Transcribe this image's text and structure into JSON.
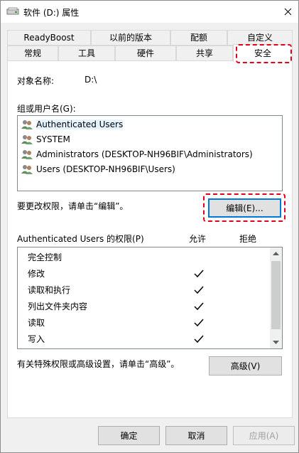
{
  "window": {
    "title": "软件 (D:) 属性"
  },
  "tabs_row1": [
    "ReadyBoost",
    "以前的版本",
    "配额",
    "自定义"
  ],
  "tabs_row2": [
    "常规",
    "工具",
    "硬件",
    "共享",
    "安全"
  ],
  "selected_tab": "安全",
  "object": {
    "label": "对象名称:",
    "value": "D:\\"
  },
  "group_label": "组或用户名(G):",
  "users": [
    "Authenticated Users",
    "SYSTEM",
    "Administrators (DESKTOP-NH96BIF\\Administrators)",
    "Users (DESKTOP-NH96BIF\\Users)"
  ],
  "edit_hint": "要更改权限，请单击“编辑”。",
  "edit_button": "编辑(E)...",
  "perm_header": {
    "title": "Authenticated Users 的权限(P)",
    "allow": "允许",
    "deny": "拒绝"
  },
  "permissions": [
    {
      "name": "完全控制",
      "allow": false
    },
    {
      "name": "修改",
      "allow": true
    },
    {
      "name": "读取和执行",
      "allow": true
    },
    {
      "name": "列出文件夹内容",
      "allow": true
    },
    {
      "name": "读取",
      "allow": true
    },
    {
      "name": "写入",
      "allow": true
    }
  ],
  "advanced_hint": "有关特殊权限或高级设置，请单击“高级”。",
  "advanced_button": "高级(V)",
  "footer": {
    "ok": "确定",
    "cancel": "取消",
    "apply": "应用(A)"
  },
  "colors": {
    "highlight_dash": "#e0001b",
    "selection": "#e5f3ff"
  }
}
